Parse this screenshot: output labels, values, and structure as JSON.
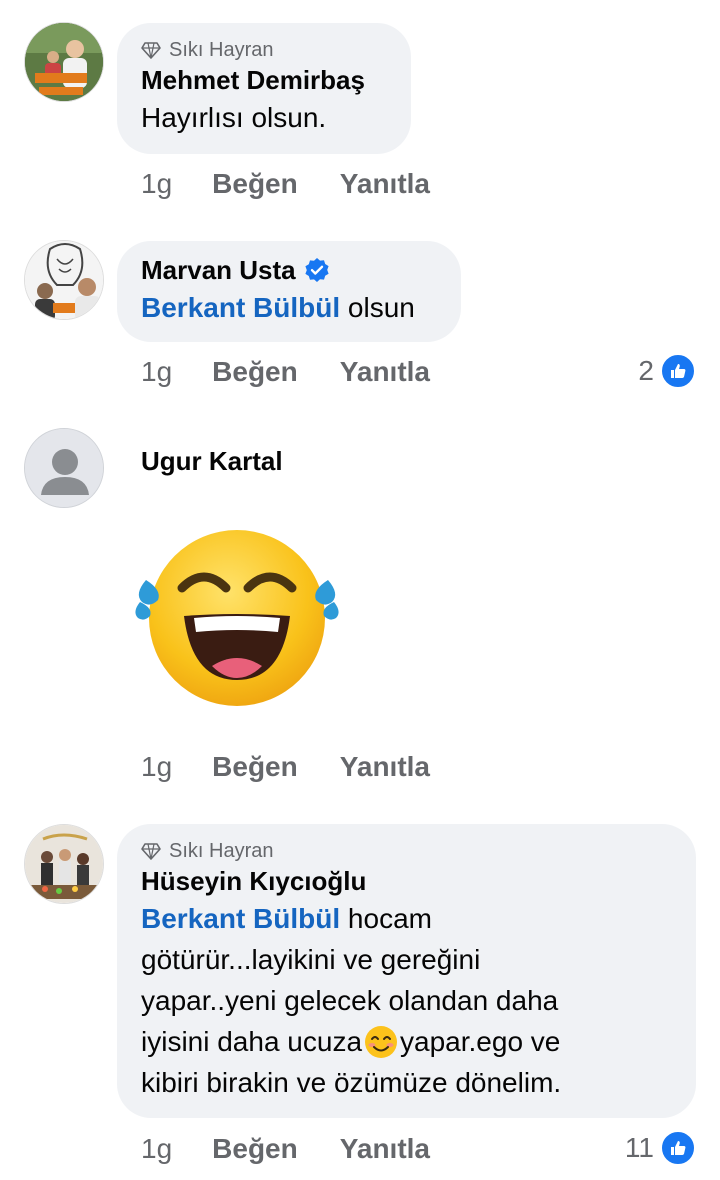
{
  "comments": [
    {
      "badge": "Sıkı Hayran",
      "author": "Mehmet Demirbaş",
      "text": "Hayırlısı olsun.",
      "time": "1g",
      "like": "Beğen",
      "reply": "Yanıtla"
    },
    {
      "author": "Marvan Usta",
      "mention": "Berkant Bülbül",
      "text": "olsun",
      "time": "1g",
      "like": "Beğen",
      "reply": "Yanıtla",
      "reaction_count": "2"
    },
    {
      "author": "Ugur Kartal",
      "sticker": "laughing-with-tears-emoji",
      "time": "1g",
      "like": "Beğen",
      "reply": "Yanıtla"
    },
    {
      "badge": "Sıkı Hayran",
      "author": "Hüseyin Kıycıoğlu",
      "mention": "Berkant Bülbül",
      "text_line1": "hocam",
      "text_line2": "götürür...layikini ve gereğini",
      "text_line3": "yapar..yeni gelecek olandan daha",
      "text_line4a": "iyisini daha ucuza",
      "text_line4b": "yapar.ego ve",
      "text_line5": "kibiri birakin ve özümüze dönelim.",
      "time": "1g",
      "like": "Beğen",
      "reply": "Yanıtla",
      "reaction_count": "11"
    }
  ],
  "colors": {
    "bubble": "#f0f2f5",
    "mention": "#1565c0",
    "secondary_text": "#65676b",
    "like_blue": "#1877f2"
  }
}
